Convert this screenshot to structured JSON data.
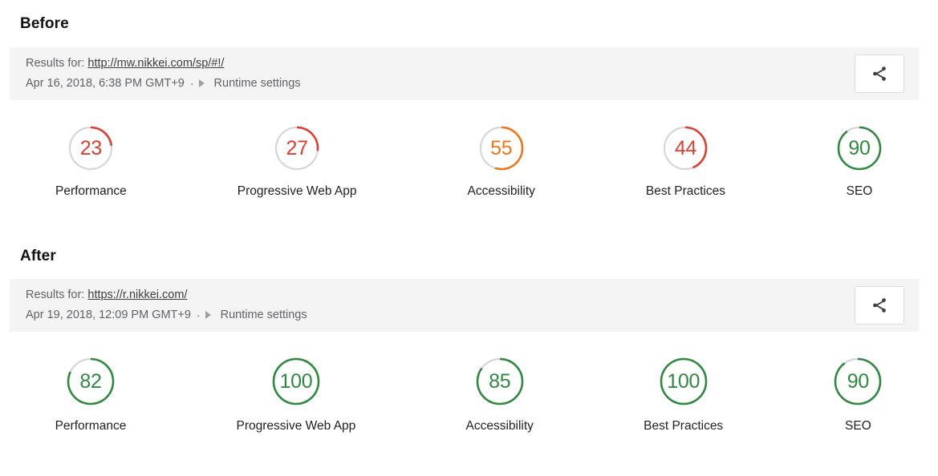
{
  "sections": [
    {
      "heading": "Before",
      "header": {
        "results_label": "Results for:",
        "url": "http://mw.nikkei.com/sp/#!/",
        "timestamp": "Apr 16, 2018, 6:38 PM GMT+9",
        "separator": "·",
        "runtime_settings": "Runtime settings",
        "share_icon": "share-icon",
        "caret_icon": "caret-right-icon",
        "background_color": "#f4f4f4"
      },
      "scores": [
        {
          "value": "23",
          "label": "Performance",
          "color": "#df3d2f",
          "percent": 23
        },
        {
          "value": "27",
          "label": "Progressive Web App",
          "color": "#df3d2f",
          "percent": 27
        },
        {
          "value": "55",
          "label": "Accessibility",
          "color": "#ef7518",
          "percent": 55
        },
        {
          "value": "44",
          "label": "Best Practices",
          "color": "#df3d2f",
          "percent": 44
        },
        {
          "value": "90",
          "label": "SEO",
          "color": "#2f8a3f",
          "percent": 90
        }
      ]
    },
    {
      "heading": "After",
      "header": {
        "results_label": "Results for:",
        "url": "https://r.nikkei.com/",
        "timestamp": "Apr 19, 2018, 12:09 PM GMT+9",
        "separator": "·",
        "runtime_settings": "Runtime settings",
        "share_icon": "share-icon",
        "caret_icon": "caret-right-icon",
        "background_color": "#f4f4f4"
      },
      "scores": [
        {
          "value": "82",
          "label": "Performance",
          "color": "#2f8a3f",
          "percent": 82
        },
        {
          "value": "100",
          "label": "Progressive Web App",
          "color": "#2f8a3f",
          "percent": 100
        },
        {
          "value": "85",
          "label": "Accessibility",
          "color": "#2f8a3f",
          "percent": 85
        },
        {
          "value": "100",
          "label": "Best Practices",
          "color": "#2f8a3f",
          "percent": 100
        },
        {
          "value": "90",
          "label": "SEO",
          "color": "#2f8a3f",
          "percent": 90
        }
      ]
    }
  ],
  "colors": {
    "fail": "#df3d2f",
    "average": "#ef7518",
    "pass": "#2f8a3f",
    "track": "#d6d6d6",
    "header_bg": "#f4f4f4"
  }
}
